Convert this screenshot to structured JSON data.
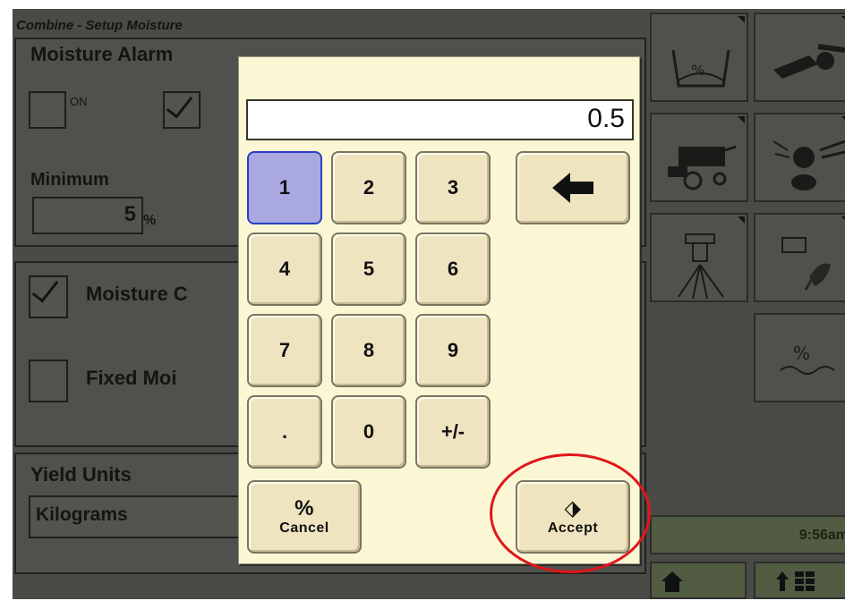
{
  "page": {
    "title": "Combine - Setup Moisture"
  },
  "moisture_alarm": {
    "title": "Moisture Alarm",
    "on_label": "ON",
    "on_checked": false,
    "off_checked": true,
    "minimum_label": "Minimum",
    "minimum_value": "5",
    "minimum_unit": "%"
  },
  "moisture_correction": {
    "label": "Moisture C",
    "checked": true
  },
  "fixed_moisture": {
    "label": "Fixed Moi",
    "checked": false
  },
  "yield_units": {
    "title": "Yield Units",
    "value": "Kilograms"
  },
  "keypad": {
    "display_value": "0.5",
    "keys": [
      "1",
      "2",
      "3",
      "4",
      "5",
      "6",
      "7",
      "8",
      "9",
      ".",
      "0",
      "+/-"
    ],
    "selected_key": "1",
    "cancel_label": "Cancel",
    "cancel_symbol": "%",
    "accept_label": "Accept",
    "accept_symbol": "⬗"
  },
  "status": {
    "time": "9:56am"
  },
  "colors": {
    "dialog_bg": "#fbf7d4",
    "key_bg": "#efe4c0",
    "selected_key_bg": "#a9a8e0",
    "annotation_ring": "#e0161b"
  }
}
